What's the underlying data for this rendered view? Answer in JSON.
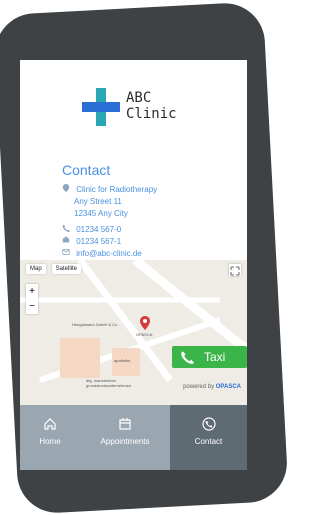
{
  "brand": {
    "line1": "ABC",
    "line2": "Clinic",
    "accent": "#4a90e2",
    "logo_blue": "#2a6fd6",
    "logo_teal": "#2aa7b5"
  },
  "contact": {
    "title": "Contact",
    "address_lines": [
      "Clinic for Radiotherapy",
      "Any Street 11",
      "12345 Any City"
    ],
    "phone": "01234 567-0",
    "fax": "01234 567-1",
    "email": "info@abc-clinic.de"
  },
  "map": {
    "tabs": [
      "Map",
      "Satellite"
    ],
    "zoom_in": "+",
    "zoom_out": "−",
    "labels": [
      "Hengstmann GmbH & Co",
      "OPASCA",
      "apotheke",
      "dtg. mannheimer grundstucksunternehmen"
    ],
    "taxi_label": "Taxi",
    "powered_by_prefix": "powered by",
    "powered_by_brand": "OPASCA"
  },
  "tabs": [
    {
      "id": "home",
      "label": "Home"
    },
    {
      "id": "appointments",
      "label": "Appointments"
    },
    {
      "id": "contact",
      "label": "Contact",
      "active": true
    }
  ]
}
